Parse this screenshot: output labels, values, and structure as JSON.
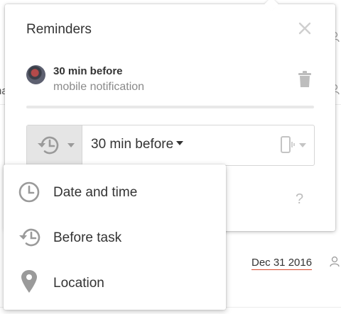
{
  "background": {
    "fragments": [
      "na",
      "na"
    ],
    "task_date": "Dec 31 2016",
    "date_underline_color": "#d9482b"
  },
  "popup": {
    "title": "Reminders",
    "close_icon": "close-icon",
    "reminder": {
      "title": "30 min before",
      "subtitle": "mobile notification",
      "avatar": "user-avatar",
      "delete_icon": "trash-icon"
    },
    "editor": {
      "type_icon": "clock-history-icon",
      "value": "30 min before",
      "device_icon": "mobile-device-icon"
    },
    "help": "?"
  },
  "menu": {
    "items": [
      {
        "label": "Date and time",
        "icon": "clock-icon"
      },
      {
        "label": "Before task",
        "icon": "clock-history-icon"
      },
      {
        "label": "Location",
        "icon": "location-pin-icon"
      }
    ]
  }
}
